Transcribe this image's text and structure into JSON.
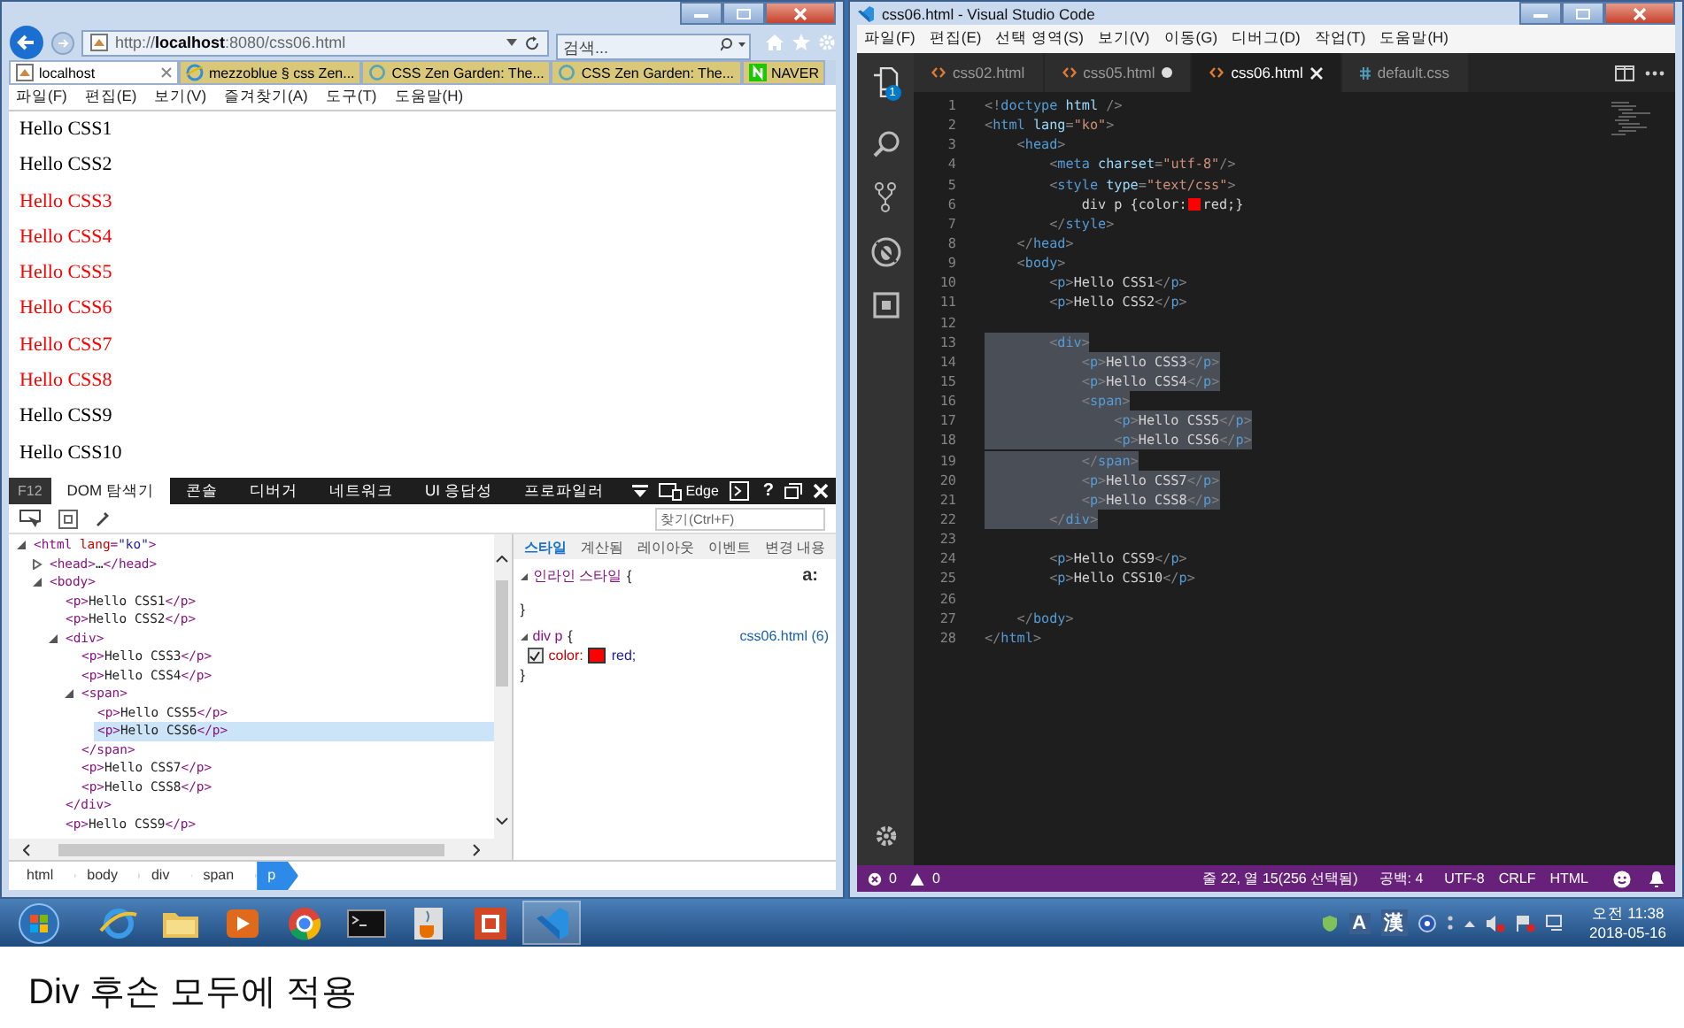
{
  "ie": {
    "address": "http://**localhost**:8080/css06.html",
    "search": {
      "placeholder": "검색..."
    },
    "tabs": [
      {
        "label": "localhost",
        "kind": "page",
        "selected": true
      },
      {
        "label": "mezzoblue § css Zen...",
        "kind": "ie",
        "selected": false
      },
      {
        "label": "CSS Zen Garden: The...",
        "kind": "ring",
        "selected": false
      },
      {
        "label": "CSS Zen Garden: The...",
        "kind": "ring",
        "selected": false
      },
      {
        "label": "NAVER",
        "kind": "naver",
        "selected": false
      }
    ],
    "menu": [
      "파일(F)",
      "편집(E)",
      "보기(V)",
      "즐겨찾기(A)",
      "도구(T)",
      "도움말(H)"
    ],
    "paragraphs": [
      {
        "text": "Hello CSS1",
        "color": "#000000"
      },
      {
        "text": "Hello CSS2",
        "color": "#000000"
      },
      {
        "text": "Hello CSS3",
        "color": "#ff0000"
      },
      {
        "text": "Hello CSS4",
        "color": "#ff0000"
      },
      {
        "text": "Hello CSS5",
        "color": "#ff0000"
      },
      {
        "text": "Hello CSS6",
        "color": "#ff0000"
      },
      {
        "text": "Hello CSS7",
        "color": "#ff0000"
      },
      {
        "text": "Hello CSS8",
        "color": "#ff0000"
      },
      {
        "text": "Hello CSS9",
        "color": "#000000"
      },
      {
        "text": "Hello CSS10",
        "color": "#000000"
      }
    ]
  },
  "devtools": {
    "key_label": "F12",
    "tabs": [
      {
        "label": "DOM 탐색기",
        "selected": true
      },
      {
        "label": "콘솔",
        "selected": false
      },
      {
        "label": "디버거",
        "selected": false
      },
      {
        "label": "네트워크",
        "selected": false
      },
      {
        "label": "UI 응답성",
        "selected": false
      },
      {
        "label": "프로파일러",
        "selected": false
      }
    ],
    "device_label": "Edge",
    "help": "?",
    "find": {
      "placeholder": "찾기(Ctrl+F)"
    },
    "dom_tree": [
      {
        "text": "<html lang=\"ko\">",
        "expanded": true,
        "selected": false,
        "children": [
          {
            "text": "<head>…</head>",
            "expanded": false,
            "selected": false
          },
          {
            "text": "<body>",
            "expanded": true,
            "selected": false,
            "children": [
              {
                "text": "<p>Hello CSS1</p>",
                "selected": false
              },
              {
                "text": "<p>Hello CSS2</p>",
                "selected": false
              },
              {
                "text": "<div>",
                "expanded": true,
                "selected": false,
                "close": "</div>",
                "children": [
                  {
                    "text": "<p>Hello CSS3</p>",
                    "selected": false
                  },
                  {
                    "text": "<p>Hello CSS4</p>",
                    "selected": false
                  },
                  {
                    "text": "<span>",
                    "expanded": true,
                    "selected": false,
                    "close": "</span>",
                    "children": [
                      {
                        "text": "<p>Hello CSS5</p>",
                        "selected": false
                      },
                      {
                        "text": "<p>Hello CSS6</p>",
                        "selected": true
                      }
                    ]
                  },
                  {
                    "text": "<p>Hello CSS7</p>",
                    "selected": false
                  },
                  {
                    "text": "<p>Hello CSS8</p>",
                    "selected": false
                  }
                ]
              },
              {
                "text": "<p>Hello CSS9</p>",
                "selected": false
              }
            ]
          }
        ]
      }
    ],
    "style_tabs": [
      {
        "label": "스타일",
        "selected": true
      },
      {
        "label": "계산됨",
        "selected": false
      },
      {
        "label": "레이아웃",
        "selected": false
      },
      {
        "label": "이벤트",
        "selected": false
      },
      {
        "label": "변경 내용",
        "selected": false
      }
    ],
    "inline_rule": {
      "selector": "인라인 스타일",
      "open": "{",
      "close": "}",
      "state_label": "a:"
    },
    "rules": [
      {
        "selector": "div p",
        "open": "{",
        "source": "css06.html (6)",
        "close": "}",
        "declarations": [
          {
            "property": "color:",
            "color": "#ff0000",
            "value": "red;",
            "checked": true
          }
        ]
      }
    ],
    "breadcrumb": [
      {
        "label": "html",
        "selected": false
      },
      {
        "label": "body",
        "selected": false
      },
      {
        "label": "div",
        "selected": false
      },
      {
        "label": "span",
        "selected": false
      },
      {
        "label": "p",
        "selected": true
      }
    ]
  },
  "vscode": {
    "title": "css06.html - Visual Studio Code",
    "menu": [
      "파일(F)",
      "편집(E)",
      "선택 영역(S)",
      "보기(V)",
      "이동(G)",
      "디버그(D)",
      "작업(T)",
      "도움말(H)"
    ],
    "badge": "1",
    "tabs": [
      {
        "label": "css02.html",
        "kind": "html",
        "selected": false,
        "modified": false
      },
      {
        "label": "css05.html",
        "kind": "html",
        "selected": false,
        "modified": true
      },
      {
        "label": "css06.html",
        "kind": "html",
        "selected": true,
        "modified": false
      },
      {
        "label": "default.css",
        "kind": "css",
        "selected": false,
        "modified": false
      }
    ],
    "lines": [
      {
        "num": "1",
        "text": "<!doctype html />",
        "selected": false
      },
      {
        "num": "2",
        "text": "<html lang=\"ko\">",
        "selected": false
      },
      {
        "num": "3",
        "text": "    <head>",
        "selected": false
      },
      {
        "num": "4",
        "text": "        <meta charset=\"utf-8\"/>",
        "selected": false
      },
      {
        "num": "5",
        "text": "        <style type=\"text/css\">",
        "selected": false
      },
      {
        "num": "6",
        "text": "            div p {color:",
        "color": "#ff0000",
        "after": "red;}",
        "selected": false
      },
      {
        "num": "7",
        "text": "        </style>",
        "selected": false
      },
      {
        "num": "8",
        "text": "    </head>",
        "selected": false
      },
      {
        "num": "9",
        "text": "    <body>",
        "selected": false
      },
      {
        "num": "10",
        "text": "        <p>Hello CSS1</p>",
        "selected": false
      },
      {
        "num": "11",
        "text": "        <p>Hello CSS2</p>",
        "selected": false
      },
      {
        "num": "12",
        "selected": false
      },
      {
        "num": "13",
        "text": "        <div>",
        "selected": true
      },
      {
        "num": "14",
        "text": "            <p>Hello CSS3</p>",
        "selected": true
      },
      {
        "num": "15",
        "text": "            <p>Hello CSS4</p>",
        "selected": true
      },
      {
        "num": "16",
        "text": "            <span>",
        "selected": true
      },
      {
        "num": "17",
        "text": "                <p>Hello CSS5</p>",
        "selected": true
      },
      {
        "num": "18",
        "text": "                <p>Hello CSS6</p>",
        "selected": true
      },
      {
        "num": "19",
        "text": "            </span>",
        "selected": true
      },
      {
        "num": "20",
        "text": "            <p>Hello CSS7</p>",
        "selected": true
      },
      {
        "num": "21",
        "text": "            <p>Hello CSS8</p>",
        "selected": true
      },
      {
        "num": "22",
        "text": "        </div>",
        "selected": true
      },
      {
        "num": "23",
        "selected": false
      },
      {
        "num": "24",
        "text": "        <p>Hello CSS9</p>",
        "selected": false
      },
      {
        "num": "25",
        "text": "        <p>Hello CSS10</p>",
        "selected": false
      },
      {
        "num": "26",
        "selected": false
      },
      {
        "num": "27",
        "text": "    </body>",
        "selected": false
      },
      {
        "num": "28",
        "text": "</html>",
        "selected": false
      }
    ],
    "status": {
      "errors": "0",
      "warnings": "0",
      "position": "줄 22, 열 15(256 선택됨)",
      "spaces": "공백: 4",
      "encoding": "UTF-8",
      "eol": "CRLF",
      "language": "HTML"
    }
  },
  "taskbar": {
    "apps": [
      {
        "kind": "ie"
      },
      {
        "kind": "folder"
      },
      {
        "kind": "media"
      },
      {
        "kind": "chrome"
      },
      {
        "kind": "terminal"
      },
      {
        "kind": "java"
      },
      {
        "kind": "office"
      },
      {
        "kind": "vscode"
      }
    ],
    "tray": {
      "ime_mode": "A",
      "hanja": "漢",
      "time": "오전 11:38",
      "date": "2018-05-16"
    }
  },
  "caption": "Div 후손 모두에 적용"
}
